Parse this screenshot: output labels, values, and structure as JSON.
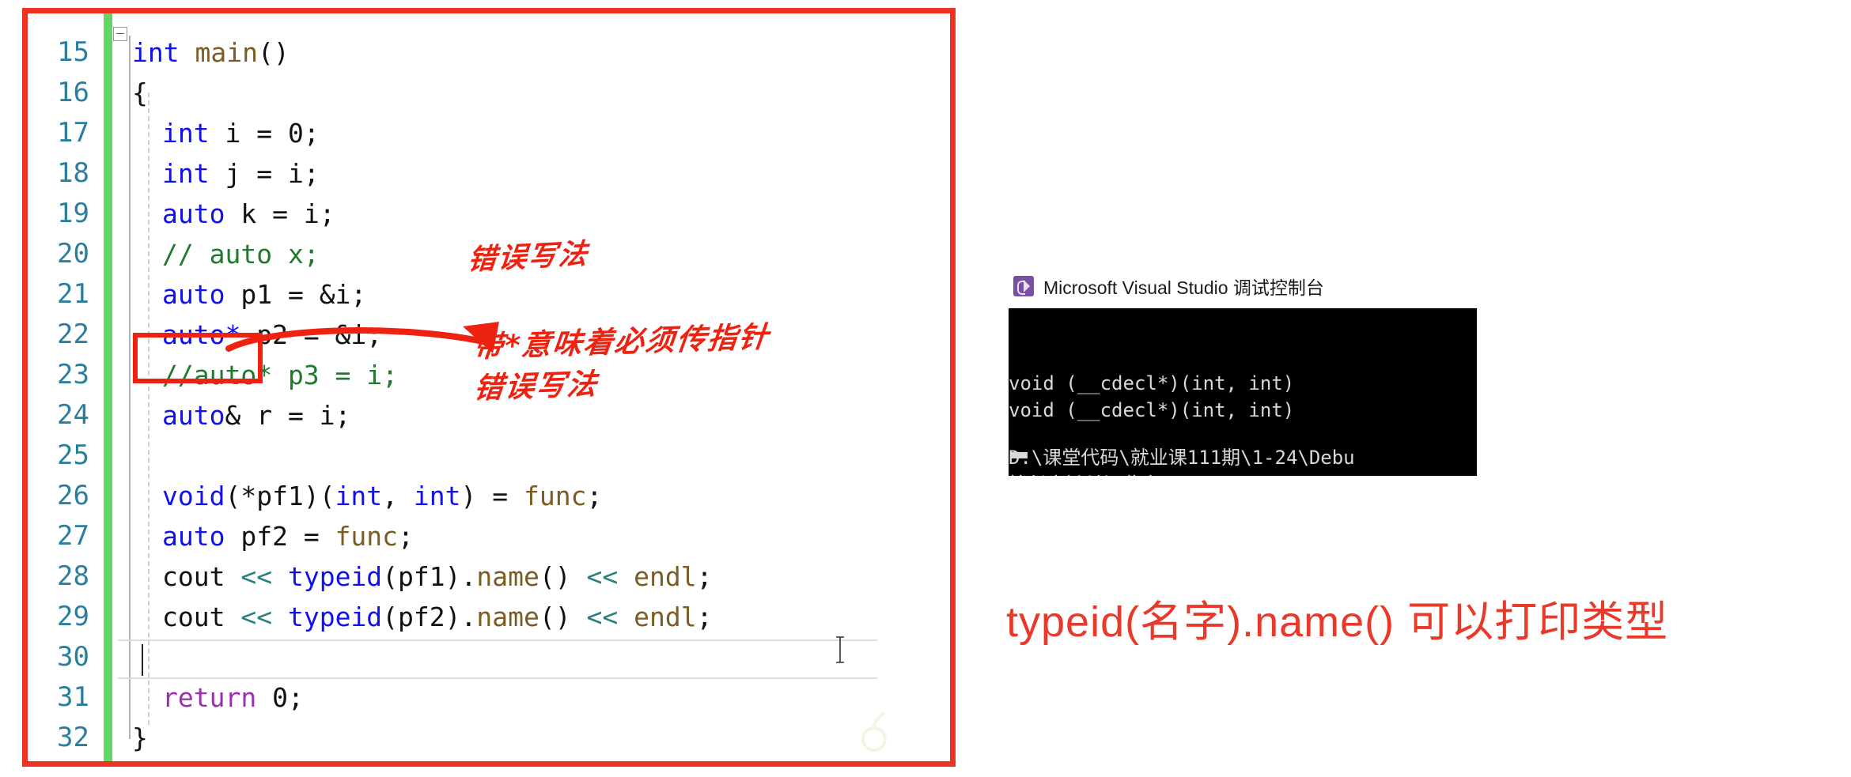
{
  "editor": {
    "accent_border_color": "#ee3322",
    "change_bar_color": "#62d765",
    "gutter_color": "#2b7f9e",
    "lines": [
      {
        "no": "15",
        "indent": 0,
        "tokens": [
          {
            "t": "int",
            "c": "kw"
          },
          {
            "t": " ",
            "c": "op"
          },
          {
            "t": "main",
            "c": "fn"
          },
          {
            "t": "()",
            "c": "punct"
          }
        ]
      },
      {
        "no": "16",
        "indent": 0,
        "tokens": [
          {
            "t": "{",
            "c": "punct"
          }
        ]
      },
      {
        "no": "17",
        "indent": 1,
        "tokens": [
          {
            "t": "int",
            "c": "kw"
          },
          {
            "t": " i = ",
            "c": "op"
          },
          {
            "t": "0",
            "c": "num"
          },
          {
            "t": ";",
            "c": "punct"
          }
        ]
      },
      {
        "no": "18",
        "indent": 1,
        "tokens": [
          {
            "t": "int",
            "c": "kw"
          },
          {
            "t": " j = i;",
            "c": "op"
          }
        ]
      },
      {
        "no": "19",
        "indent": 1,
        "tokens": [
          {
            "t": "auto",
            "c": "kw"
          },
          {
            "t": " k = i;",
            "c": "op"
          }
        ]
      },
      {
        "no": "20",
        "indent": 1,
        "tokens": [
          {
            "t": "// auto x;",
            "c": "cmt"
          }
        ]
      },
      {
        "no": "21",
        "indent": 1,
        "tokens": [
          {
            "t": "auto",
            "c": "kw"
          },
          {
            "t": " p1 = &i;",
            "c": "op"
          }
        ]
      },
      {
        "no": "22",
        "indent": 1,
        "tokens": [
          {
            "t": "auto*",
            "c": "kw"
          },
          {
            "t": " p2 = &i;",
            "c": "op"
          }
        ]
      },
      {
        "no": "23",
        "indent": 1,
        "tokens": [
          {
            "t": "//auto* p3 = i;",
            "c": "cmt"
          }
        ]
      },
      {
        "no": "24",
        "indent": 1,
        "tokens": [
          {
            "t": "auto",
            "c": "kw"
          },
          {
            "t": "& r = i;",
            "c": "op"
          }
        ]
      },
      {
        "no": "25",
        "indent": 1,
        "tokens": [
          {
            "t": "",
            "c": "op"
          }
        ]
      },
      {
        "no": "26",
        "indent": 1,
        "tokens": [
          {
            "t": "void",
            "c": "kw"
          },
          {
            "t": "(*pf1)(",
            "c": "op"
          },
          {
            "t": "int",
            "c": "kw"
          },
          {
            "t": ", ",
            "c": "op"
          },
          {
            "t": "int",
            "c": "kw"
          },
          {
            "t": ") = ",
            "c": "op"
          },
          {
            "t": "func",
            "c": "fn"
          },
          {
            "t": ";",
            "c": "punct"
          }
        ]
      },
      {
        "no": "27",
        "indent": 1,
        "tokens": [
          {
            "t": "auto",
            "c": "kw"
          },
          {
            "t": " pf2 = ",
            "c": "op"
          },
          {
            "t": "func",
            "c": "fn"
          },
          {
            "t": ";",
            "c": "punct"
          }
        ]
      },
      {
        "no": "28",
        "indent": 1,
        "tokens": [
          {
            "t": "cout",
            "c": "ident"
          },
          {
            "t": " << ",
            "c": "stream"
          },
          {
            "t": "typeid",
            "c": "typeid"
          },
          {
            "t": "(pf1).",
            "c": "op"
          },
          {
            "t": "name",
            "c": "fn"
          },
          {
            "t": "() ",
            "c": "op"
          },
          {
            "t": "<< ",
            "c": "stream"
          },
          {
            "t": "endl",
            "c": "fn"
          },
          {
            "t": ";",
            "c": "punct"
          }
        ]
      },
      {
        "no": "29",
        "indent": 1,
        "tokens": [
          {
            "t": "cout",
            "c": "ident"
          },
          {
            "t": " << ",
            "c": "stream"
          },
          {
            "t": "typeid",
            "c": "typeid"
          },
          {
            "t": "(pf2).",
            "c": "op"
          },
          {
            "t": "name",
            "c": "fn"
          },
          {
            "t": "() ",
            "c": "op"
          },
          {
            "t": "<< ",
            "c": "stream"
          },
          {
            "t": "endl",
            "c": "fn"
          },
          {
            "t": ";",
            "c": "punct"
          }
        ]
      },
      {
        "no": "30",
        "indent": 1,
        "tokens": [
          {
            "t": "",
            "c": "op"
          }
        ]
      },
      {
        "no": "31",
        "indent": 1,
        "tokens": [
          {
            "t": "return",
            "c": "kw-ret"
          },
          {
            "t": " ",
            "c": "op"
          },
          {
            "t": "0",
            "c": "num"
          },
          {
            "t": ";",
            "c": "punct"
          }
        ]
      },
      {
        "no": "32",
        "indent": 0,
        "tokens": [
          {
            "t": "}",
            "c": "punct"
          }
        ]
      }
    ]
  },
  "annotations": {
    "color": "#ee2211",
    "highlight_box_target": "auto*",
    "note_wrong_syntax_1": "错误写法",
    "note_pointer_required": "带*意味着必须传指针",
    "note_wrong_syntax_2": "错误写法"
  },
  "console": {
    "title": "Microsoft Visual Studio 调试控制台",
    "lines": [
      "void (__cdecl*)(int, int)",
      "void (__cdecl*)(int, int)",
      "",
      "D:\\课堂代码\\就业课111期\\1-24\\Debu",
      "按任意键关闭此窗口. . ."
    ]
  },
  "caption": {
    "text": "typeid(名字).name() 可以打印类型",
    "color": "#e8392b"
  }
}
